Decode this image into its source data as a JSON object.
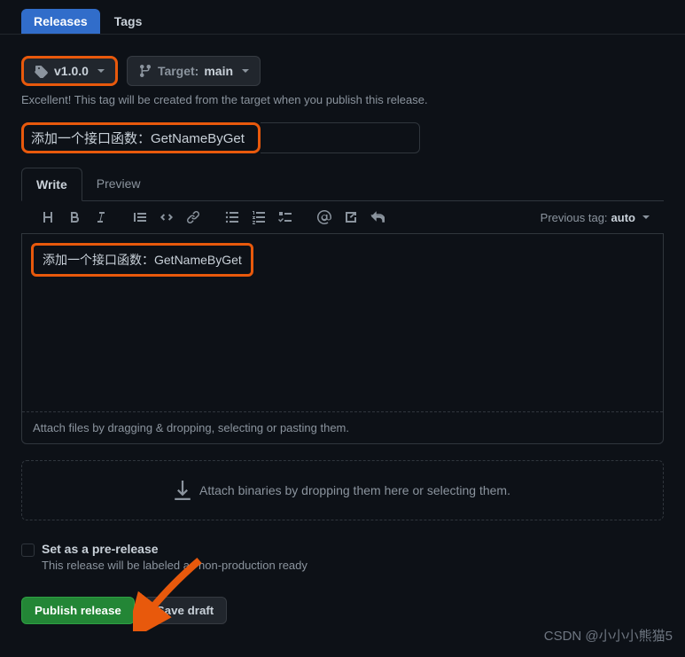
{
  "tabs": {
    "releases": "Releases",
    "tags": "Tags"
  },
  "tag_selector": {
    "value": "v1.0.0"
  },
  "target": {
    "label": "Target:",
    "value": "main"
  },
  "tag_help": "Excellent! This tag will be created from the target when you publish this release.",
  "release_title": "添加一个接口函数：GetNameByGet",
  "editor": {
    "write_tab": "Write",
    "preview_tab": "Preview",
    "prev_tag_label": "Previous tag:",
    "prev_tag_value": "auto",
    "body_text": "添加一个接口函数：GetNameByGet",
    "attach_hint": "Attach files by dragging & dropping, selecting or pasting them."
  },
  "binaries_drop": "Attach binaries by dropping them here or selecting them.",
  "prerelease": {
    "label": "Set as a pre-release",
    "help": "This release will be labeled as non-production ready"
  },
  "actions": {
    "publish": "Publish release",
    "save_draft": "Save draft"
  },
  "watermark": "CSDN @小小小熊猫5"
}
